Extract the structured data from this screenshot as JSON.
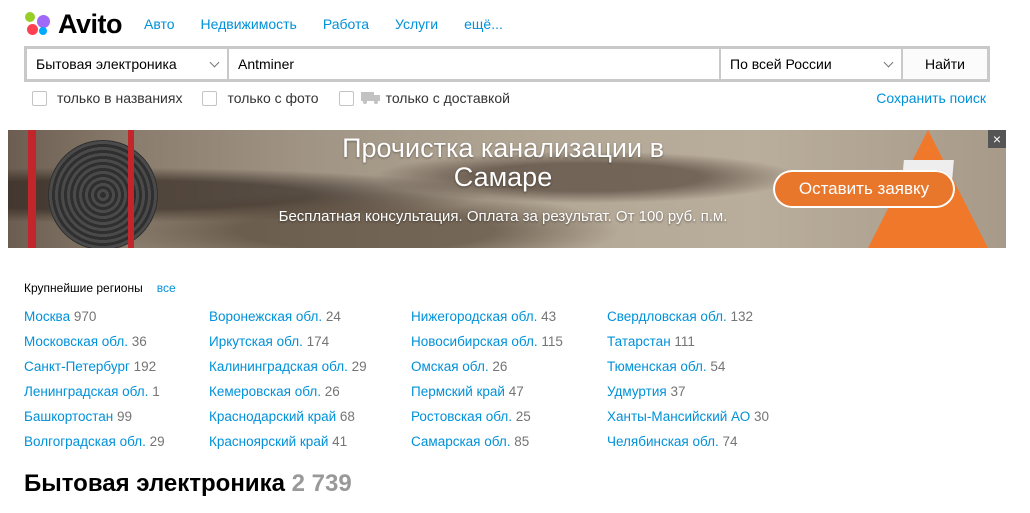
{
  "logo": {
    "text": "Avito"
  },
  "nav": [
    "Авто",
    "Недвижимость",
    "Работа",
    "Услуги",
    "ещё..."
  ],
  "search": {
    "category": "Бытовая электроника",
    "query": "Antminer",
    "region": "По всей России",
    "button": "Найти"
  },
  "filters": {
    "titles_only": "только в названиях",
    "with_photo": "только с фото",
    "with_delivery": "только с доставкой",
    "save": "Сохранить поиск"
  },
  "banner": {
    "title_line1": "Прочистка канализации в",
    "title_line2": "Самаре",
    "subtitle": "Бесплатная консультация. Оплата за результат. От 100 руб. п.м.",
    "cta": "Оставить заявку",
    "close": "×"
  },
  "regions": {
    "heading": "Крупнейшие регионы",
    "all_link": "все",
    "columns": [
      [
        {
          "name": "Москва",
          "count": "970"
        },
        {
          "name": "Московская обл.",
          "count": "36"
        },
        {
          "name": "Санкт-Петербург",
          "count": "192"
        },
        {
          "name": "Ленинградская обл.",
          "count": "1"
        },
        {
          "name": "Башкортостан",
          "count": "99"
        },
        {
          "name": "Волгоградская обл.",
          "count": "29"
        }
      ],
      [
        {
          "name": "Воронежская обл.",
          "count": "24"
        },
        {
          "name": "Иркутская обл.",
          "count": "174"
        },
        {
          "name": "Калининградская обл.",
          "count": "29"
        },
        {
          "name": "Кемеровская обл.",
          "count": "26"
        },
        {
          "name": "Краснодарский край",
          "count": "68"
        },
        {
          "name": "Красноярский край",
          "count": "41"
        }
      ],
      [
        {
          "name": "Нижегородская обл.",
          "count": "43"
        },
        {
          "name": "Новосибирская обл.",
          "count": "115"
        },
        {
          "name": "Омская обл.",
          "count": "26"
        },
        {
          "name": "Пермский край",
          "count": "47"
        },
        {
          "name": "Ростовская обл.",
          "count": "25"
        },
        {
          "name": "Самарская обл.",
          "count": "85"
        }
      ],
      [
        {
          "name": "Свердловская обл.",
          "count": "132"
        },
        {
          "name": "Татарстан",
          "count": "111"
        },
        {
          "name": "Тюменская обл.",
          "count": "54"
        },
        {
          "name": "Удмуртия",
          "count": "37"
        },
        {
          "name": "Ханты-Мансийский АО",
          "count": "30"
        },
        {
          "name": "Челябинская обл.",
          "count": "74"
        }
      ]
    ]
  },
  "category_heading": {
    "title": "Бытовая электроника",
    "count": "2 739"
  },
  "colors": {
    "link": "#0091d9",
    "cta": "#e8772c",
    "count_gray": "#757575"
  }
}
